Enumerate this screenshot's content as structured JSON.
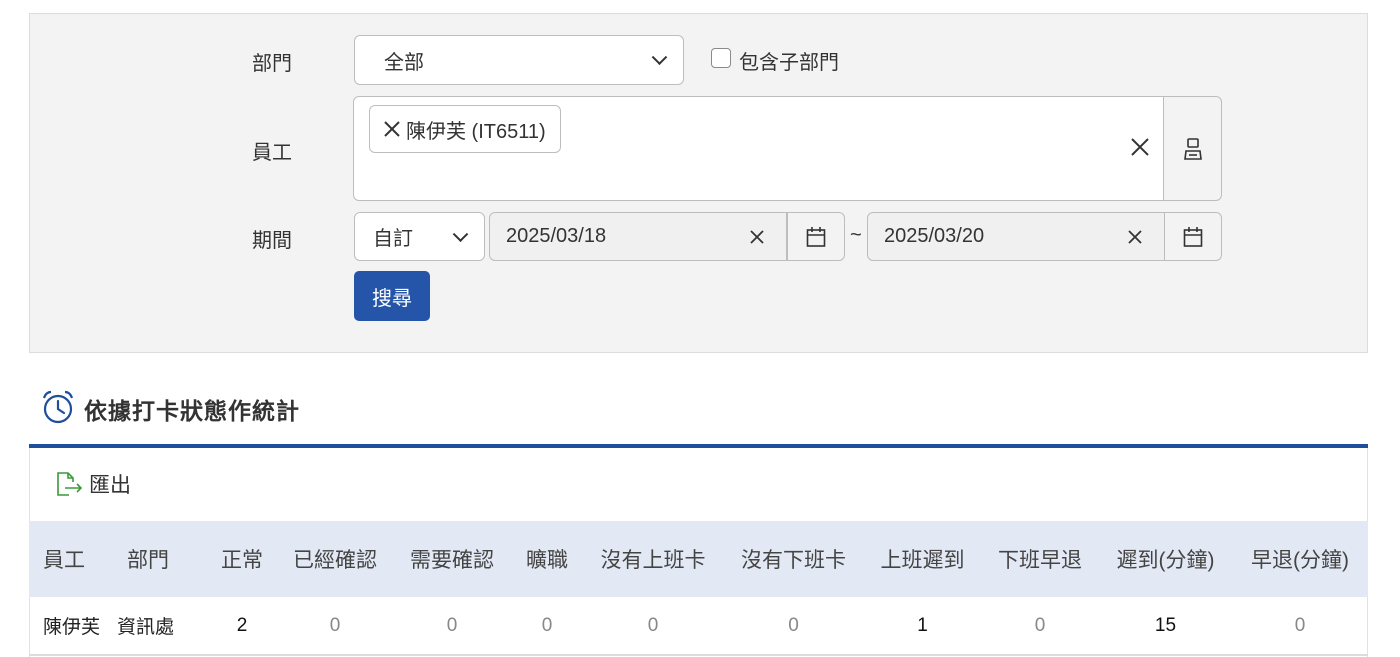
{
  "filters": {
    "department_label": "部門",
    "department_value": "全部",
    "include_sub_label": "包含子部門",
    "employee_label": "員工",
    "employee_chip": "陳伊芙 (IT6511)",
    "period_label": "期間",
    "period_mode": "自訂",
    "date_start": "2025/03/18",
    "date_end": "2025/03/20",
    "date_separator": "~",
    "search_button": "搜尋"
  },
  "stats": {
    "title": "依據打卡狀態作統計",
    "export_label": "匯出",
    "columns": [
      "員工",
      "部門",
      "正常",
      "已經確認",
      "需要確認",
      "曠職",
      "沒有上班卡",
      "沒有下班卡",
      "上班遲到",
      "下班早退",
      "遲到(分鐘)",
      "早退(分鐘)"
    ],
    "rows": [
      [
        "陳伊芙",
        "資訊處",
        "2",
        "0",
        "0",
        "0",
        "0",
        "0",
        "1",
        "0",
        "15",
        "0"
      ]
    ]
  },
  "colors": {
    "primary": "#2555a8",
    "rule": "#1f4e9c",
    "header_bg": "#e3e9f4",
    "export_icon": "#3a9a3a"
  },
  "icons": [
    "chevron-down-icon",
    "close-icon",
    "person-select-icon",
    "calendar-icon",
    "alarm-clock-icon",
    "export-icon"
  ]
}
